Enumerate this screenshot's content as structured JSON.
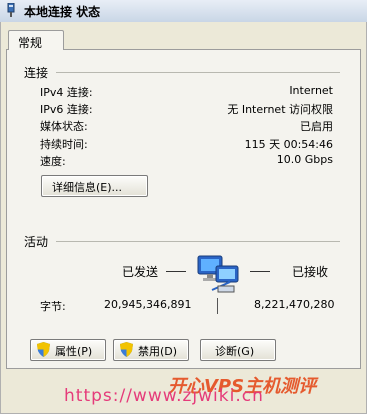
{
  "window": {
    "title": "本地连接 状态"
  },
  "tabs": [
    {
      "label": "常规"
    }
  ],
  "connection": {
    "section_label": "连接",
    "rows": [
      {
        "label": "IPv4 连接:",
        "value": "Internet"
      },
      {
        "label": "IPv6 连接:",
        "value": "无 Internet 访问权限"
      },
      {
        "label": "媒体状态:",
        "value": "已启用"
      },
      {
        "label": "持续时间:",
        "value": "115 天 00:54:46"
      },
      {
        "label": "速度:",
        "value": "10.0 Gbps"
      }
    ],
    "details_button": "详细信息(E)..."
  },
  "activity": {
    "section_label": "活动",
    "sent_label": "已发送",
    "received_label": "已接收",
    "bytes_label": "字节:",
    "bytes_sent": "20,945,346,891",
    "bytes_received": "8,221,470,280",
    "icon": "network-computers-icon"
  },
  "buttons": {
    "properties": "属性(P)",
    "disable": "禁用(D)",
    "diagnose": "诊断(G)"
  },
  "watermark": {
    "url": "https://www.zjwiki.cn",
    "brand": "开心VPS主机测评"
  },
  "colors": {
    "watermark_url": "#e53b7a",
    "watermark_brand": "#e55a2e"
  }
}
